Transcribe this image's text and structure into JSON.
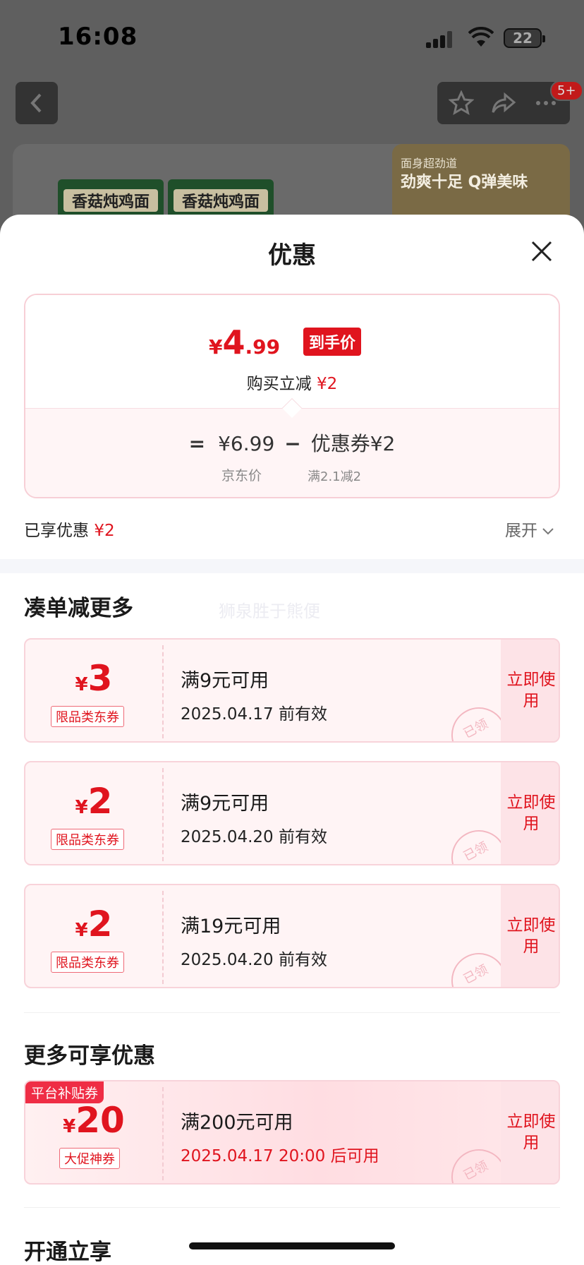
{
  "status_bar": {
    "time": "16:08",
    "battery": "22"
  },
  "background": {
    "badge": "5+",
    "pack_label": "香菇炖鸡面",
    "banner_line1": "面身超劲道",
    "banner_line2": "劲爽十足 Q弹美味"
  },
  "sheet": {
    "title": "优惠",
    "final_price": {
      "currency": "¥",
      "integer": "4",
      "decimal": ".99",
      "tag": "到手价"
    },
    "buy_cut": {
      "label": "购买立减",
      "amount": "¥2"
    },
    "formula": {
      "equals": "=",
      "jd_price": "¥6.99",
      "minus": "−",
      "coupon": "优惠券¥2",
      "jd_label": "京东价",
      "coupon_cond": "满2.1减2"
    },
    "enjoyed": {
      "label": "已享优惠",
      "amount": "¥2"
    },
    "expand_label": "展开",
    "section1_title": "凑单减更多",
    "watermark": "狮泉胜于熊便",
    "coupons": [
      {
        "currency": "¥",
        "value": "3",
        "kind": "限品类东券",
        "condition": "满9元可用",
        "date": "2025.04.17 前有效",
        "use": "立即使用",
        "stamp": "已领"
      },
      {
        "currency": "¥",
        "value": "2",
        "kind": "限品类东券",
        "condition": "满9元可用",
        "date": "2025.04.20 前有效",
        "use": "立即使用",
        "stamp": "已领"
      },
      {
        "currency": "¥",
        "value": "2",
        "kind": "限品类东券",
        "condition": "满19元可用",
        "date": "2025.04.20 前有效",
        "use": "立即使用",
        "stamp": "已领"
      }
    ],
    "section2_title": "更多可享优惠",
    "big_coupon": {
      "platform_tag": "平台补贴券",
      "currency": "¥",
      "value": "20",
      "kind": "大促神券",
      "condition": "满200元可用",
      "date": "2025.04.17 20:00 后可用",
      "use": "立即使用",
      "stamp": "已领"
    },
    "section3_title": "开通立享"
  }
}
